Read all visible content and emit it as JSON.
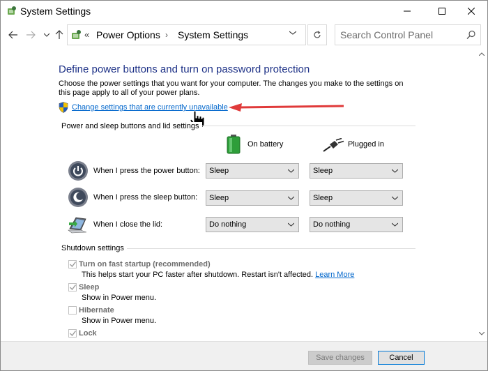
{
  "window": {
    "title": "System Settings"
  },
  "nav": {
    "breadcrumb_prefix": "«",
    "crumbs": [
      "Power Options",
      "System Settings"
    ],
    "search_placeholder": "Search Control Panel"
  },
  "page": {
    "heading": "Define power buttons and turn on password protection",
    "description": "Choose the power settings that you want for your computer. The changes you make to the settings on this page apply to all of your power plans.",
    "change_link": "Change settings that are currently unavailable"
  },
  "power_section": {
    "label": "Power and sleep buttons and lid settings",
    "col_battery": "On battery",
    "col_plugged": "Plugged in",
    "rows": [
      {
        "label": "When I press the power button:",
        "battery": "Sleep",
        "plugged": "Sleep"
      },
      {
        "label": "When I press the sleep button:",
        "battery": "Sleep",
        "plugged": "Sleep"
      },
      {
        "label": "When I close the lid:",
        "battery": "Do nothing",
        "plugged": "Do nothing"
      }
    ]
  },
  "shutdown_section": {
    "label": "Shutdown settings",
    "fast_startup": {
      "label": "Turn on fast startup (recommended)",
      "checked": true,
      "desc": "This helps start your PC faster after shutdown. Restart isn't affected.",
      "link": "Learn More"
    },
    "sleep": {
      "label": "Sleep",
      "checked": true,
      "desc": "Show in Power menu."
    },
    "hibernate": {
      "label": "Hibernate",
      "checked": false,
      "desc": "Show in Power menu."
    },
    "lock": {
      "label": "Lock",
      "checked": true
    }
  },
  "footer": {
    "save_label": "Save changes",
    "cancel_label": "Cancel"
  },
  "colors": {
    "heading": "#1e3287",
    "link": "#0066cc",
    "annotation_arrow": "#e03a3a"
  }
}
